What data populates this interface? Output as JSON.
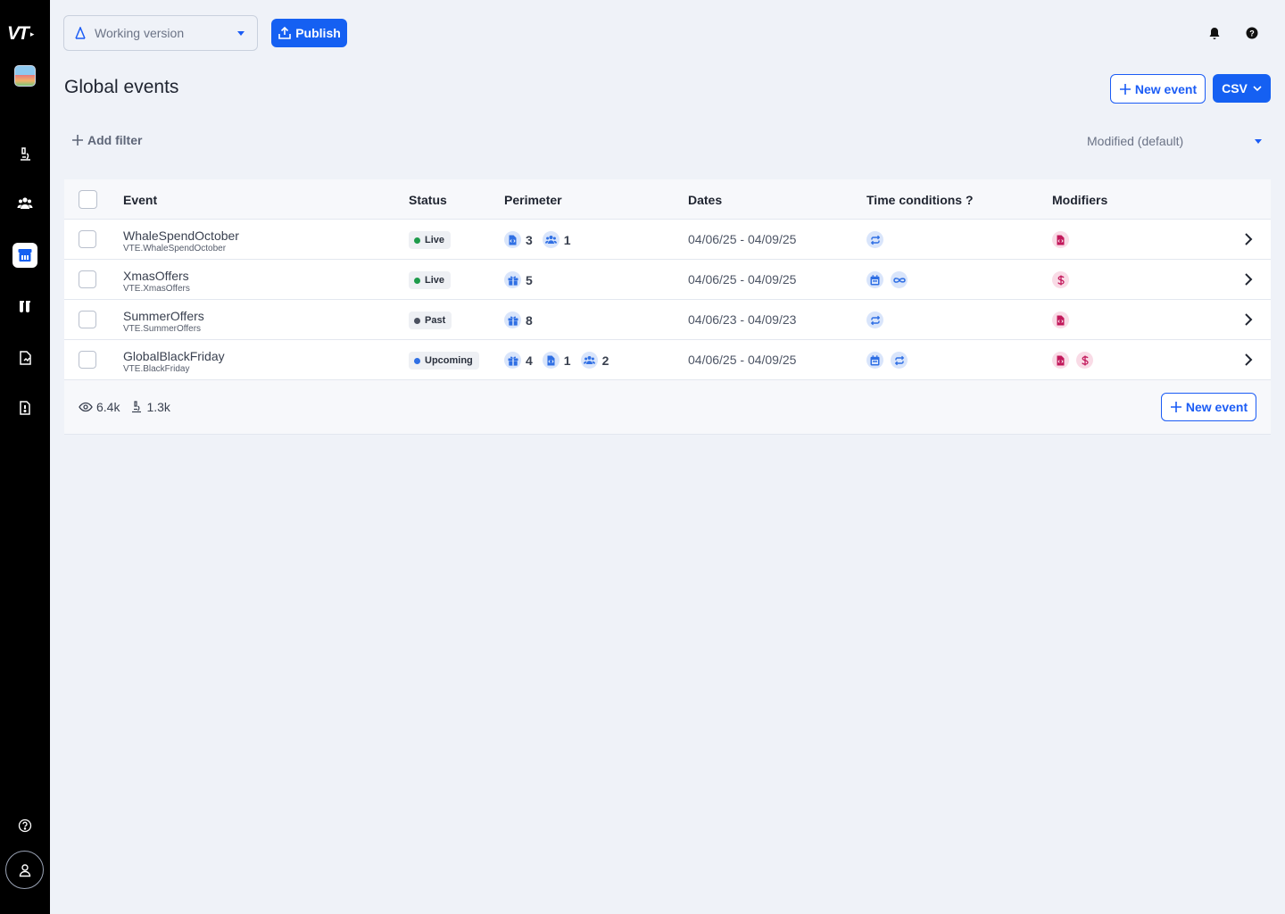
{
  "app": {
    "logo_text": "VT"
  },
  "topbar": {
    "version_label": "Working version",
    "publish_label": "Publish"
  },
  "page": {
    "title": "Global events",
    "new_event_label": "New event",
    "csv_label": "CSV",
    "add_filter_label": "Add filter",
    "sort_label": "Modified (default)"
  },
  "table": {
    "headers": {
      "event": "Event",
      "status": "Status",
      "perimeter": "Perimeter",
      "dates": "Dates",
      "time_conditions": "Time conditions ?",
      "modifiers": "Modifiers"
    },
    "rows": [
      {
        "name": "WhaleSpendOctober",
        "key": "VTE.WhaleSpendOctober",
        "status": "Live",
        "status_color": "#1e9b4b",
        "perimeter": [
          {
            "icon": "file-code-icon",
            "count": "3"
          },
          {
            "icon": "users-icon",
            "count": "1"
          }
        ],
        "dates": "04/06/25 - 04/09/25",
        "time_conditions": [
          "repeat-icon"
        ],
        "modifiers": [
          "file-code-icon"
        ]
      },
      {
        "name": "XmasOffers",
        "key": "VTE.XmasOffers",
        "status": "Live",
        "status_color": "#1e9b4b",
        "perimeter": [
          {
            "icon": "gift-icon",
            "count": "5"
          }
        ],
        "dates": "04/06/25 - 04/09/25",
        "time_conditions": [
          "calendar-icon",
          "infinity-icon"
        ],
        "modifiers": [
          "dollar-icon"
        ]
      },
      {
        "name": "SummerOffers",
        "key": "VTE.SummerOffers",
        "status": "Past",
        "status_color": "#4b5160",
        "perimeter": [
          {
            "icon": "gift-icon",
            "count": "8"
          }
        ],
        "dates": "04/06/23 - 04/09/23",
        "time_conditions": [
          "repeat-icon"
        ],
        "modifiers": [
          "file-code-icon"
        ]
      },
      {
        "name": "GlobalBlackFriday",
        "key": "VTE.BlackFriday",
        "status": "Upcoming",
        "status_color": "#2f6fe4",
        "perimeter": [
          {
            "icon": "gift-icon",
            "count": "4"
          },
          {
            "icon": "file-code-icon",
            "count": "1"
          },
          {
            "icon": "users-icon",
            "count": "2"
          }
        ],
        "dates": "04/06/25 - 04/09/25",
        "time_conditions": [
          "calendar-icon",
          "repeat-icon"
        ],
        "modifiers": [
          "file-code-icon",
          "dollar-icon"
        ]
      }
    ],
    "footer": {
      "views": "6.4k",
      "users": "1.3k",
      "new_event_label": "New event"
    }
  },
  "colors": {
    "accent": "#1560f2",
    "sidebar": "#000000",
    "background": "#eff2f8"
  }
}
